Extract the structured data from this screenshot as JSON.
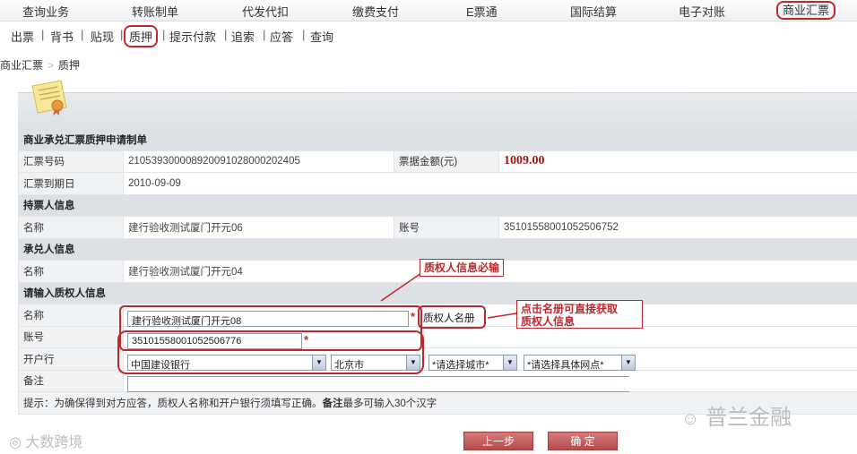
{
  "top_nav": [
    "查询业务",
    "转账制单",
    "代发代扣",
    "缴费支付",
    "E票通",
    "国际结算",
    "电子对账",
    "商业汇票"
  ],
  "sub_nav": [
    "出票",
    "背书",
    "贴现",
    "质押",
    "提示付款",
    "追索",
    "应答",
    "查询"
  ],
  "breadcrumb": [
    "商业汇票",
    "质押"
  ],
  "form": {
    "title": "商业承兑汇票质押申请制单",
    "bill_no_label": "汇票号码",
    "bill_no": "210539300008920091028000202405",
    "amount_label": "票据金额(元)",
    "amount": "1009.00",
    "due_label": "汇票到期日",
    "due_date": "2010-09-09",
    "holder_section": "持票人信息",
    "holder_name_label": "名称",
    "holder_name": "建行验收测试厦门开元06",
    "holder_acct_label": "账号",
    "holder_acct": "35101558001052506752",
    "acceptor_section": "承兑人信息",
    "acceptor_name_label": "名称",
    "acceptor_name": "建行验收测试厦门开元04",
    "pledgee_section": "请输入质权人信息",
    "pledgee_name_label": "名称",
    "pledgee_name": "建行验收测试厦门开元08",
    "pledgee_register_link": "质权人名册",
    "pledgee_acct_label": "账号",
    "pledgee_acct": "35101558001052506776",
    "bank_label": "开户行",
    "bank_select": "中国建设银行",
    "province_select": "北京市",
    "city_select": "*请选择城市*",
    "branch_select": "*请选择具体网点*",
    "remark_label": "备注",
    "remark": "",
    "hint_prefix": "提示：为确保得到对方应答，质权人名称和开户银行须填写正确。",
    "hint_bold": "备注",
    "hint_suffix": "最多可输入30个汉字",
    "required_mark": "*"
  },
  "annotations": {
    "pledgee_required": "质权人信息必输",
    "click_register_line1": "点击名册可直接获取",
    "click_register_line2": "质权人信息"
  },
  "buttons": {
    "prev": "上一步",
    "confirm": "确  定"
  },
  "watermarks": {
    "right": "普兰金融",
    "left": "大数跨境"
  },
  "colors": {
    "annotation_red": "#c0282d",
    "amount_red": "#a01616",
    "button_red": "#b44c4c"
  }
}
